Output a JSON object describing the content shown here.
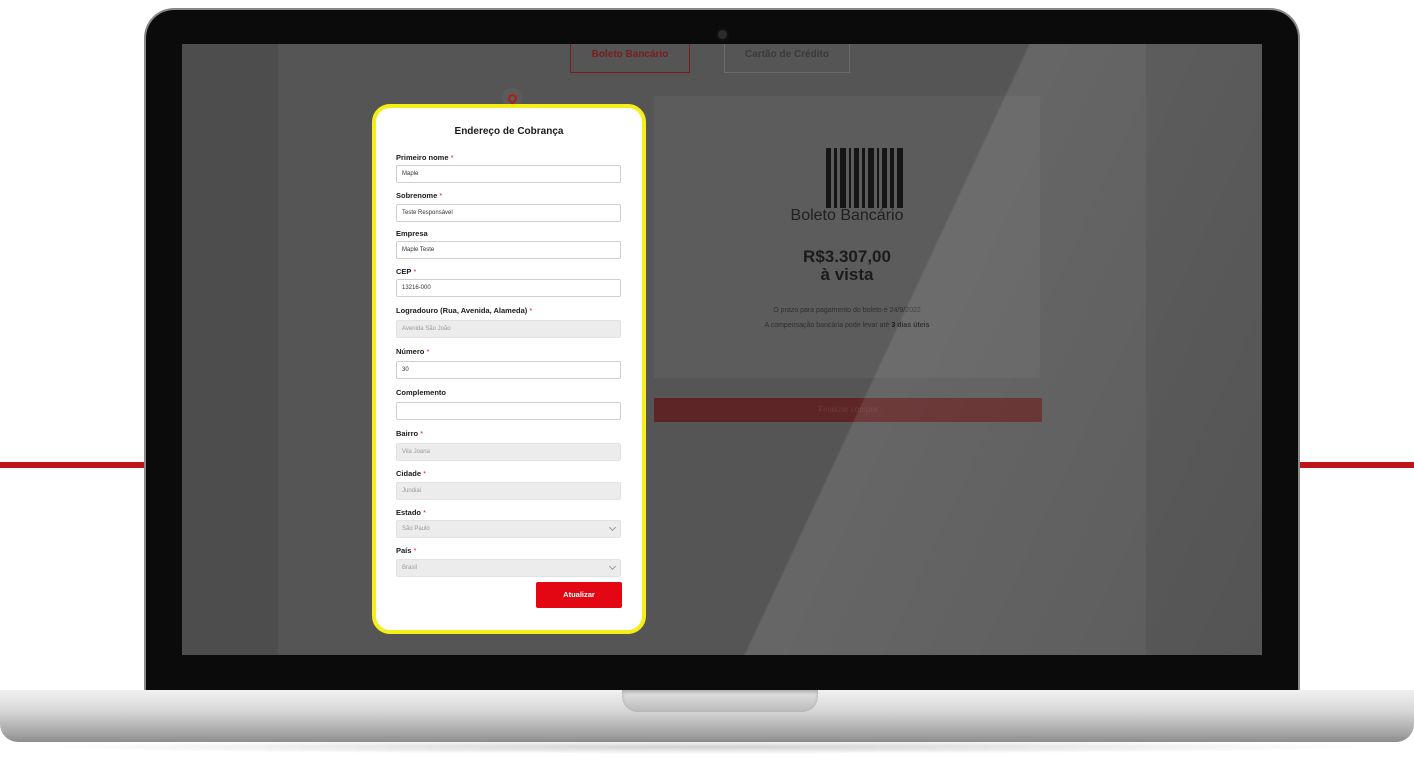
{
  "background_tabs": {
    "boleto_label": "Boleto Bancário",
    "card_label": "Cartão de Crédito"
  },
  "payment": {
    "method_title": "Boleto Bancário",
    "amount": "R$3.307,00",
    "condition": "à vista",
    "note_line1": "O prazo para pagamento do boleto é 24/9/2022",
    "note_line2_prefix": "A compensação bancária pode levar até ",
    "note_line2_bold": "3 dias úteis",
    "finalize_label": "Finalizar compra"
  },
  "modal": {
    "title": "Endereço de Cobrança",
    "required_marker": "*",
    "fields": {
      "first_name": {
        "label": "Primeiro nome",
        "value": "Maple"
      },
      "last_name": {
        "label": "Sobrenome",
        "value": "Teste Responsável"
      },
      "company": {
        "label": "Empresa",
        "value": "Maple Teste"
      },
      "cep": {
        "label": "CEP",
        "value": "13216-000"
      },
      "street": {
        "label": "Logradouro (Rua, Avenida, Alameda)",
        "value": "Avenida São João"
      },
      "number": {
        "label": "Número",
        "value": "30"
      },
      "complement": {
        "label": "Complemento",
        "value": ""
      },
      "district": {
        "label": "Bairro",
        "value": "Vila Joana"
      },
      "city": {
        "label": "Cidade",
        "value": "Jundiaí"
      },
      "state": {
        "label": "Estado",
        "value": "São Paulo"
      },
      "country": {
        "label": "País",
        "value": "Brasil"
      }
    },
    "update_label": "Atualizar"
  },
  "colors": {
    "accent": "#e30613",
    "highlight": "#f5ee17"
  }
}
